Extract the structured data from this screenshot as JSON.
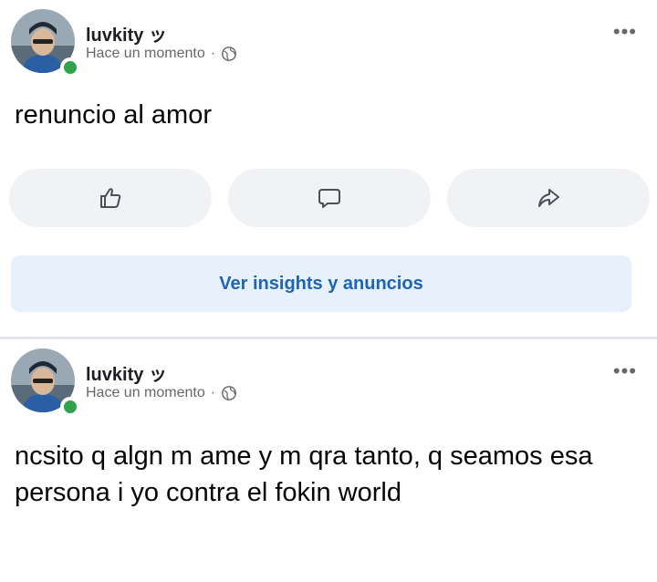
{
  "posts": [
    {
      "author": "luvkity ッ",
      "timestamp": "Hace un momento",
      "separator": "·",
      "text": "renuncio al amor",
      "more_icon": "more-dots-icon",
      "actions": [
        {
          "icon": "like-icon"
        },
        {
          "icon": "comment-icon"
        },
        {
          "icon": "share-icon"
        }
      ],
      "insights_label": "Ver insights y anuncios"
    },
    {
      "author": "luvkity ッ",
      "timestamp": "Hace un momento",
      "separator": "·",
      "text": "ncsito q algn m ame y m qra tanto, q seamos esa persona i yo contra el fokin world",
      "more_icon": "more-dots-icon"
    }
  ],
  "colors": {
    "online": "#31a24c",
    "insights_bg": "#e7f1fb",
    "insights_text": "#1d63b8",
    "action_bg": "#f0f2f5",
    "meta_text": "#65676b"
  }
}
